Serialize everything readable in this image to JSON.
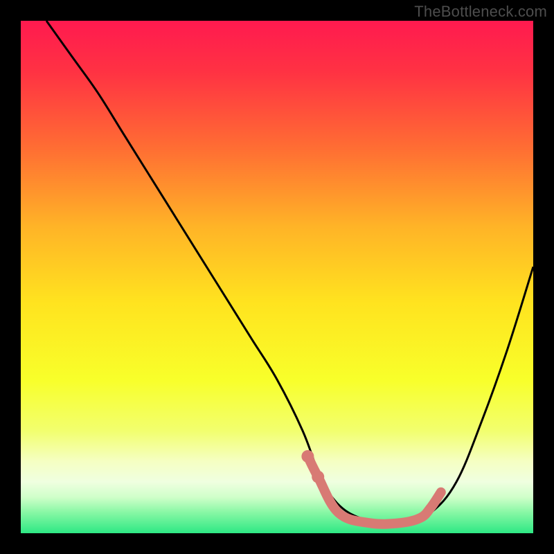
{
  "watermark": "TheBottleneck.com",
  "gradient": {
    "stops": [
      {
        "offset": 0.0,
        "color": "#ff1a4f"
      },
      {
        "offset": 0.1,
        "color": "#ff3243"
      },
      {
        "offset": 0.25,
        "color": "#ff6e33"
      },
      {
        "offset": 0.4,
        "color": "#ffb327"
      },
      {
        "offset": 0.55,
        "color": "#ffe31f"
      },
      {
        "offset": 0.7,
        "color": "#f8ff2a"
      },
      {
        "offset": 0.8,
        "color": "#f2ff6e"
      },
      {
        "offset": 0.86,
        "color": "#f5ffc3"
      },
      {
        "offset": 0.9,
        "color": "#efffe0"
      },
      {
        "offset": 0.93,
        "color": "#cfffc9"
      },
      {
        "offset": 0.96,
        "color": "#86f7a4"
      },
      {
        "offset": 1.0,
        "color": "#2de884"
      }
    ]
  },
  "chart_data": {
    "type": "line",
    "title": "",
    "xlabel": "",
    "ylabel": "",
    "xlim": [
      0,
      100
    ],
    "ylim": [
      0,
      100
    ],
    "series": [
      {
        "name": "bottleneck-curve",
        "color": "#000000",
        "x": [
          5,
          10,
          15,
          20,
          25,
          30,
          35,
          40,
          45,
          50,
          55,
          58,
          60,
          64,
          70,
          75,
          80,
          85,
          90,
          95,
          100
        ],
        "y": [
          100,
          93,
          86,
          78,
          70,
          62,
          54,
          46,
          38,
          30,
          20,
          12,
          8,
          4,
          2,
          2,
          4,
          10,
          22,
          36,
          52
        ]
      }
    ],
    "highlight": {
      "name": "optimal-zone",
      "color": "#d87a74",
      "points": [
        {
          "x": 56,
          "y": 15
        },
        {
          "x": 58,
          "y": 11
        },
        {
          "x": 62,
          "y": 4
        },
        {
          "x": 68,
          "y": 2
        },
        {
          "x": 74,
          "y": 2
        },
        {
          "x": 78,
          "y": 3
        },
        {
          "x": 80,
          "y": 5
        },
        {
          "x": 82,
          "y": 8
        }
      ]
    }
  }
}
